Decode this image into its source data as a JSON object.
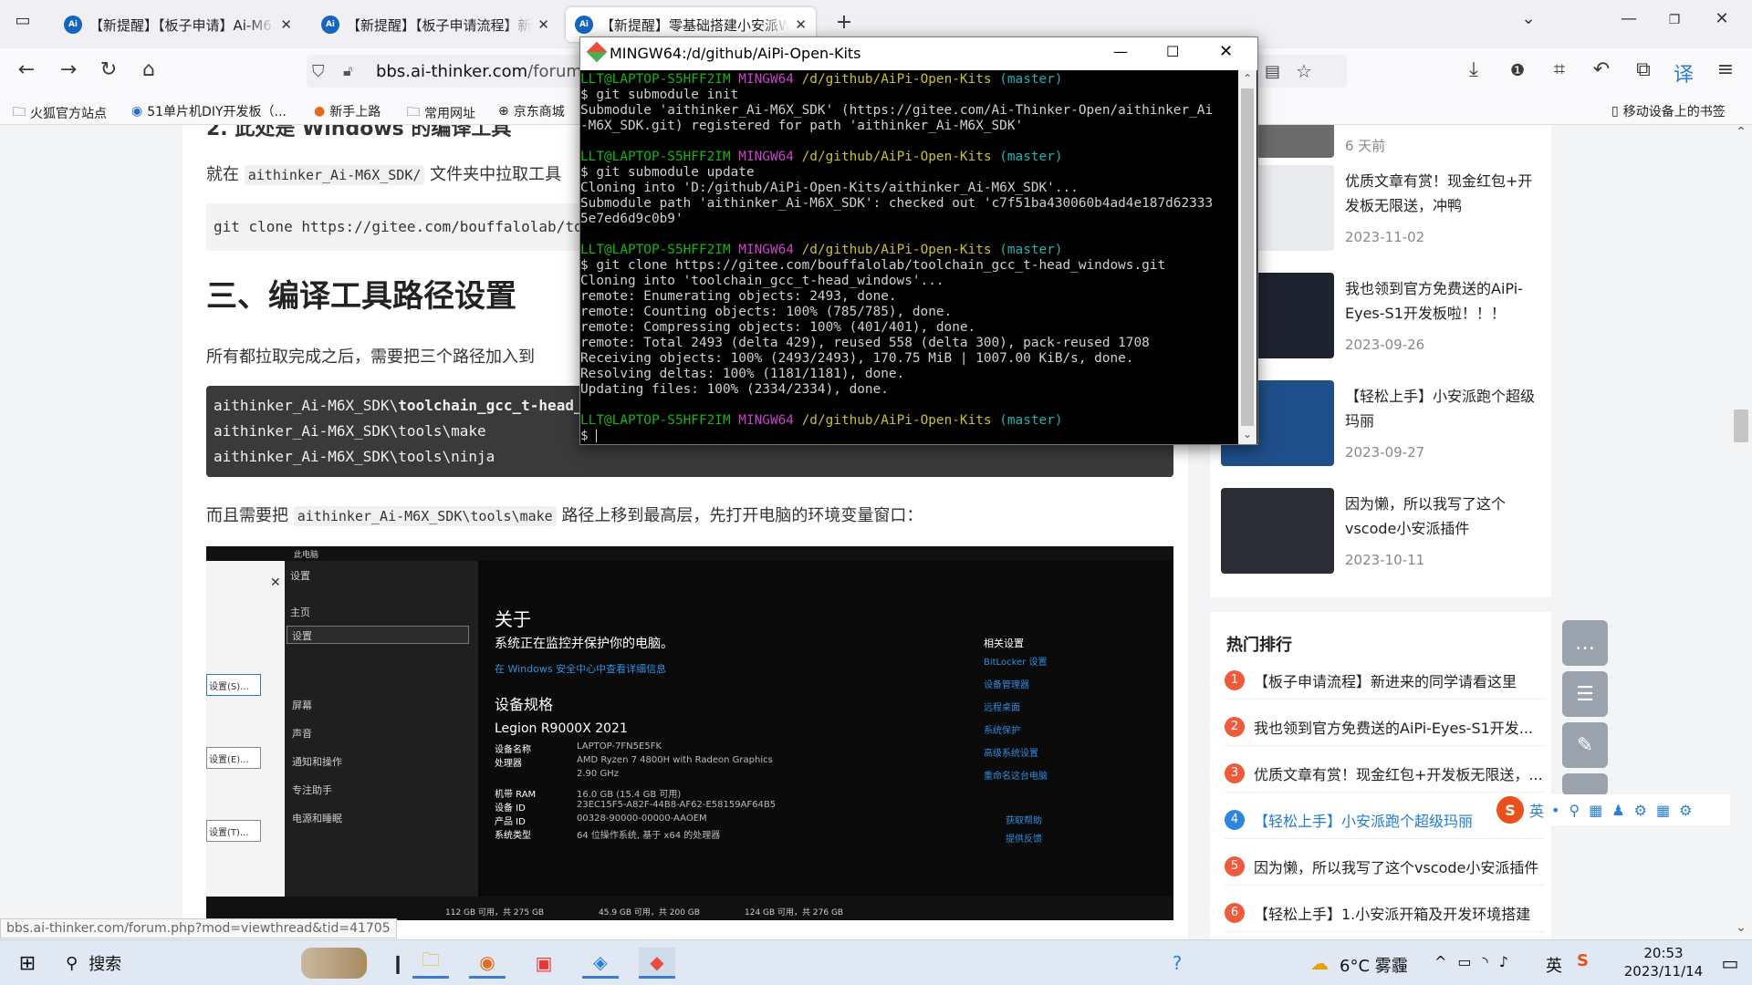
{
  "browser": {
    "tabs": [
      {
        "label": "【新提醒】【板子申请】Ai-M6X-"
      },
      {
        "label": "【新提醒】【板子申请流程】新进来"
      },
      {
        "label": "【新提醒】零基础搭建小安派W"
      }
    ],
    "url_host": "bbs.ai-thinker.com",
    "url_path": "/forum.p",
    "bookmarks": [
      "火狐官方站点",
      "51单片机DIY开发板（...",
      "新手上路",
      "常用网址",
      "京东商城"
    ],
    "mobile_bookmarks": "移动设备上的书签",
    "status_url": "bbs.ai-thinker.com/forum.php?mod=viewthread&tid=41705"
  },
  "article": {
    "top_cut_heading": "2. 此处是 Windows 的编译工具",
    "para1_prefix": "就在",
    "para1_code": "aithinker_Ai-M6X_SDK/",
    "para1_suffix": "文件夹中拉取工具",
    "clone_cmd": "git clone https://gitee.com/bouffalolab/toolc",
    "section_heading": "三、编译工具路径设置",
    "para2": "所有都拉取完成之后，需要把三个路径加入到",
    "paths": [
      "aithinker_Ai-M6X_SDK\\",
      "toolchain_gcc_t-head_w",
      "aithinker_Ai-M6X_SDK\\tools\\make",
      "aithinker_Ai-M6X_SDK\\tools\\ninja"
    ],
    "para3_prefix": "而且需要把",
    "para3_code": "aithinker_Ai-M6X_SDK\\tools\\make",
    "para3_suffix": "路径上移到最高层，先打开电脑的环境变量窗口："
  },
  "embedded": {
    "explorer_title": "此电脑",
    "settings_title": "设置",
    "home": "主页",
    "find_setting": "设置",
    "left_menu": [
      "屏幕",
      "声音",
      "通知和操作",
      "专注助手",
      "电源和睡眠"
    ],
    "btns": [
      "设置(S)...",
      "设置(E)...",
      "设置(T)..."
    ],
    "about": "关于",
    "protect": "系统正在监控并保护你的电脑。",
    "security_link": "在 Windows 安全中心中查看详细信息",
    "spec_heading": "设备规格",
    "device_model": "Legion R9000X 2021",
    "spec_rows": [
      {
        "k": "设备名称",
        "v": "LAPTOP-7FN5E5FK"
      },
      {
        "k": "处理器",
        "v": "AMD Ryzen 7 4800H with Radeon Graphics"
      },
      {
        "k": "",
        "v": "2.90 GHz"
      },
      {
        "k": "机带 RAM",
        "v": "16.0 GB (15.4 GB 可用)"
      },
      {
        "k": "设备 ID",
        "v": "23EC15F5-A82F-44B8-AF62-E58159AF64B5"
      },
      {
        "k": "产品 ID",
        "v": "00328-90000-00000-AAOEM"
      },
      {
        "k": "系统类型",
        "v": "64 位操作系统, 基于 x64 的处理器"
      }
    ],
    "related": "相关设置",
    "related_links": [
      "BitLocker 设置",
      "设备管理器",
      "远程桌面",
      "系统保护",
      "高级系统设置",
      "重命名这台电脑"
    ],
    "help": [
      "获取帮助",
      "提供反馈"
    ],
    "drives": [
      "112 GB 可用，共 275 GB",
      "45.9 GB 可用，共 200 GB",
      "124 GB 可用，共 276 GB"
    ]
  },
  "sidebar": {
    "recent": [
      {
        "title": "",
        "date": "6 天前"
      },
      {
        "title": "优质文章有赏！现金红包+开发板无限送，冲鸭",
        "date": "2023-11-02"
      },
      {
        "title": "我也领到官方免费送的AiPi-Eyes-S1开发板啦！！！",
        "date": "2023-09-26"
      },
      {
        "title": "【轻松上手】小安派跑个超级玛丽",
        "date": "2023-09-27"
      },
      {
        "title": "因为懒，所以我写了这个vscode小安派插件",
        "date": "2023-10-11"
      }
    ],
    "hot_title": "热门排行",
    "hot": [
      "【板子申请流程】新进来的同学请看这里",
      "我也领到官方免费送的AiPi-Eyes-S1开发...",
      "优质文章有赏！现金红包+开发板无限送，...",
      "【轻松上手】小安派跑个超级玛丽",
      "因为懒，所以我写了这个vscode小安派插件",
      "【轻松上手】1.小安派开箱及开发环境搭建"
    ],
    "ime_lang": "英"
  },
  "terminal": {
    "title": "MINGW64:/d/github/AiPi-Open-Kits",
    "user": "LLT@LAPTOP-S5HFF2IM",
    "env": "MINGW64",
    "path": "/d/github/AiPi-Open-Kits",
    "branch": "(master)",
    "lines": [
      "$ git submodule init",
      "Submodule 'aithinker_Ai-M6X_SDK' (https://gitee.com/Ai-Thinker-Open/aithinker_Ai",
      "-M6X_SDK.git) registered for path 'aithinker_Ai-M6X_SDK'",
      "",
      "$ git submodule update",
      "Cloning into 'D:/github/AiPi-Open-Kits/aithinker_Ai-M6X_SDK'...",
      "Submodule path 'aithinker_Ai-M6X_SDK': checked out 'c7f51ba430060b4ad4e187d62333",
      "5e7ed6d9c0b9'",
      "",
      "$ git clone https://gitee.com/bouffalolab/toolchain_gcc_t-head_windows.git",
      "Cloning into 'toolchain_gcc_t-head_windows'...",
      "remote: Enumerating objects: 2493, done.",
      "remote: Counting objects: 100% (785/785), done.",
      "remote: Compressing objects: 100% (401/401), done.",
      "remote: Total 2493 (delta 429), reused 558 (delta 300), pack-reused 1708",
      "Receiving objects: 100% (2493/2493), 170.75 MiB | 1007.00 KiB/s, done.",
      "Resolving deltas: 100% (1181/1181), done.",
      "Updating files: 100% (2334/2334), done.",
      "",
      "$ "
    ]
  },
  "taskbar": {
    "search": "搜索",
    "weather_temp": "6°C",
    "weather_desc": "雾霾",
    "ime": "英",
    "time": "20:53",
    "date": "2023/11/14"
  }
}
